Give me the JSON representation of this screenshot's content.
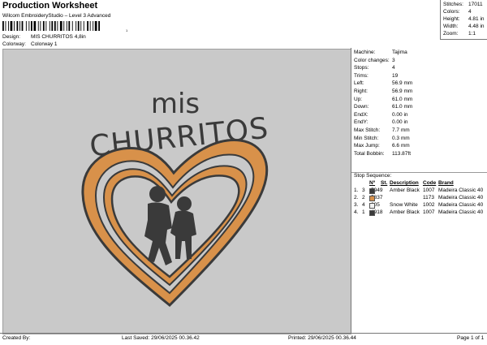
{
  "header": {
    "title": "Production Worksheet",
    "subtitle": "Wilcom EmbroideryStudio – Level 3 Advanced",
    "barcode_number": "1",
    "design_label": "Design:",
    "design_value": "MIS CHURRITOS 4,8in",
    "colorway_label": "Colorway:",
    "colorway_value": "Colorway 1"
  },
  "top_stats": [
    {
      "label": "Stitches:",
      "value": "17011"
    },
    {
      "label": "Colors:",
      "value": "4"
    },
    {
      "label": "Height:",
      "value": "4.81 in"
    },
    {
      "label": "Width:",
      "value": "4.48 in"
    },
    {
      "label": "Zoom:",
      "value": "1:1"
    }
  ],
  "design_preview": {
    "text_top": "mis",
    "text_main": "CHURRITOS",
    "thread_dark": "#3a3a3a",
    "thread_orange": "#d8914a",
    "thread_white": "#f2f2f2",
    "background": "#c9c9c9"
  },
  "machine_info": [
    {
      "label": "Machine:",
      "value": "Tajima"
    },
    {
      "label": "Color changes:",
      "value": "3"
    },
    {
      "label": "Stops:",
      "value": "4"
    },
    {
      "label": "Trims:",
      "value": "19"
    },
    {
      "label": "Left:",
      "value": "56.9 mm"
    },
    {
      "label": "Right:",
      "value": "56.9 mm"
    },
    {
      "label": "Up:",
      "value": "61.0 mm"
    },
    {
      "label": "Down:",
      "value": "61.0 mm"
    },
    {
      "label": "EndX:",
      "value": "0.00 in"
    },
    {
      "label": "EndY:",
      "value": "0.00 in"
    },
    {
      "label": "Max Stitch:",
      "value": "7.7 mm"
    },
    {
      "label": "Min Stitch:",
      "value": "0.3 mm"
    },
    {
      "label": "Max Jump:",
      "value": "6.6 mm"
    },
    {
      "label": "Total Bobbin:",
      "value": "113.87ft"
    }
  ],
  "stop_sequence": {
    "label": "Stop Sequence:",
    "headers": {
      "num": "Nº",
      "st": "St.",
      "description": "Description",
      "code": "Code",
      "brand": "Brand"
    },
    "rows": [
      {
        "idx": "1.",
        "num": "3",
        "color": "#3a3a3a",
        "st": "5949",
        "description": "Amber Black",
        "code": "1007",
        "brand": "Madeira Classic 40"
      },
      {
        "idx": "2.",
        "num": "2",
        "color": "#d8914a",
        "st": "5837",
        "description": "",
        "code": "1173",
        "brand": "Madeira Classic 40"
      },
      {
        "idx": "3.",
        "num": "4",
        "color": "#f2f2f2",
        "st": "305",
        "description": "Snow White",
        "code": "1002",
        "brand": "Madeira Classic 40"
      },
      {
        "idx": "4.",
        "num": "1",
        "color": "#3a3a3a",
        "st": "4918",
        "description": "Amber Black",
        "code": "1007",
        "brand": "Madeira Classic 40"
      }
    ]
  },
  "footer": {
    "created_by": "Created By:",
    "last_saved": "Last Saved: 29/06/2025 00.36.42",
    "printed": "Printed: 29/06/2025 00.36.44",
    "page": "Page 1 of 1"
  }
}
